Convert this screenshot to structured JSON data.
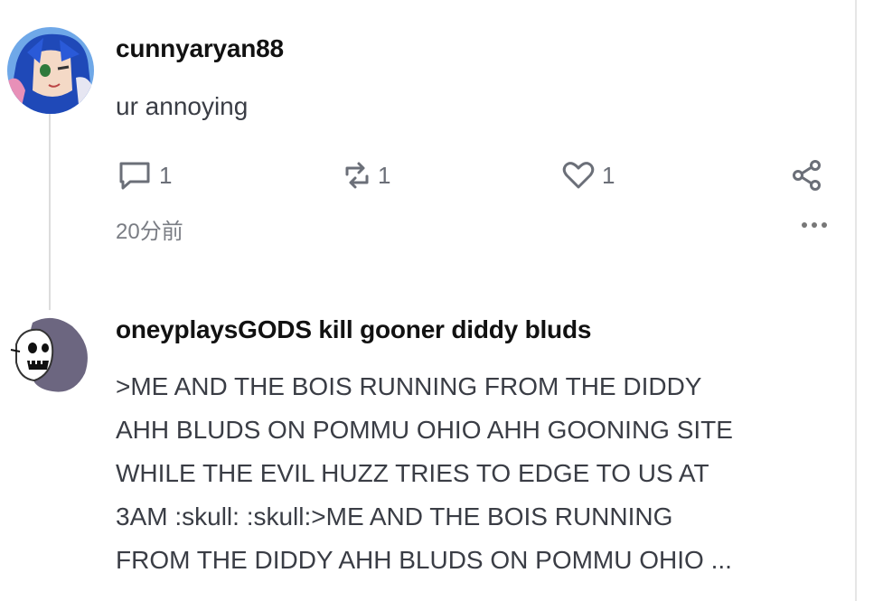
{
  "posts": [
    {
      "username": "cunnyaryan88",
      "text": "ur annoying",
      "reply_count": "1",
      "repost_count": "1",
      "like_count": "1",
      "timestamp": "20分前"
    },
    {
      "username": "oneyplaysGODS kill gooner diddy bluds",
      "text_lines": [
        ">ME AND THE BOIS RUNNING FROM THE DIDDY",
        "AHH BLUDS ON POMMU OHIO AHH GOONING SITE",
        "WHILE THE EVIL HUZZ TRIES TO EDGE TO US AT",
        "3AM :skull: :skull:>ME AND THE BOIS RUNNING",
        "FROM THE DIDDY AHH BLUDS ON POMMU OHIO ..."
      ]
    }
  ],
  "icons": {
    "reply": "comment-icon",
    "repost": "repost-icon",
    "like": "heart-icon",
    "share": "share-icon",
    "more": "more-dots-icon"
  }
}
